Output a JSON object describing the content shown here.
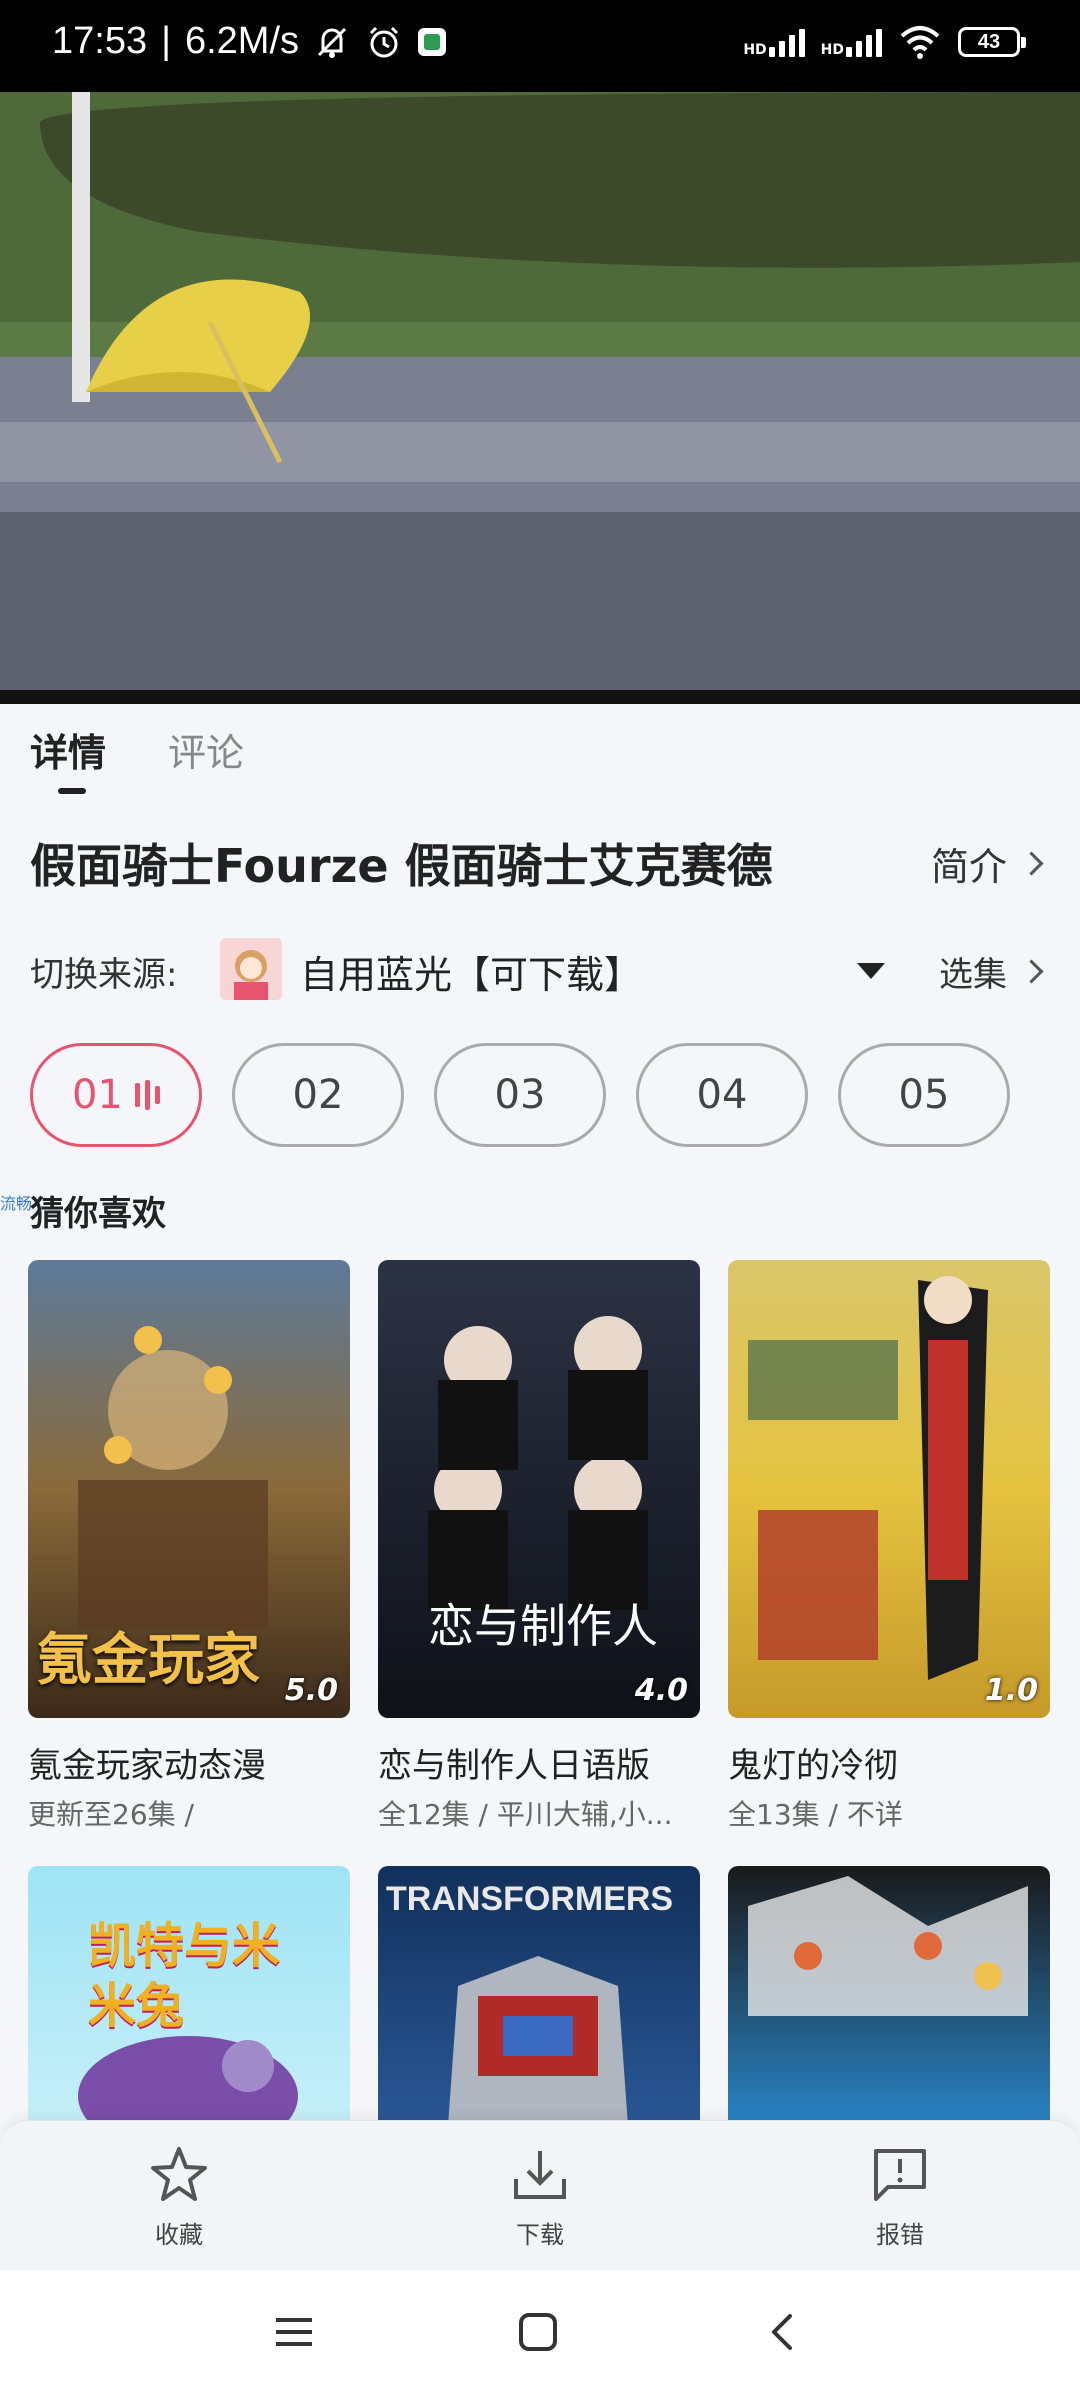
{
  "status_bar": {
    "time": "17:53",
    "speed": "6.2M/s",
    "battery": "43",
    "hd1": "HD",
    "hd2": "HD"
  },
  "tabs": [
    {
      "label": "详情",
      "active": true
    },
    {
      "label": "评论",
      "active": false
    }
  ],
  "title": "假面骑士Fourze 假面骑士艾克赛德",
  "intro_label": "简介",
  "source": {
    "label": "切换来源:",
    "name": "自用蓝光【可下载】",
    "pick_label": "选集"
  },
  "episodes": [
    "01",
    "02",
    "03",
    "04",
    "05"
  ],
  "side_tag": "流畅",
  "guess_title": "猜你喜欢",
  "cards": [
    {
      "name": "氪金玩家动态漫",
      "info": "更新至26集 /",
      "score": "5.0",
      "poster_text": "氪金玩家"
    },
    {
      "name": "恋与制作人日语版",
      "info": "全12集 / 平川大辅,小...",
      "score": "4.0",
      "poster_text": "恋与制作人"
    },
    {
      "name": "鬼灯的冷彻",
      "info": "全13集 / 不详",
      "score": "1.0",
      "poster_text": ""
    },
    {
      "name": "",
      "info": "",
      "score": "",
      "poster_text": "凯特与米米兔"
    },
    {
      "name": "",
      "info": "",
      "score": "",
      "poster_text": "TRANSFORMERS"
    },
    {
      "name": "",
      "info": "",
      "score": "",
      "poster_text": ""
    }
  ],
  "actions": {
    "favorite": "收藏",
    "download": "下载",
    "report": "报错"
  },
  "colors": {
    "accent": "#e8546e",
    "background": "#f4f6f9"
  }
}
